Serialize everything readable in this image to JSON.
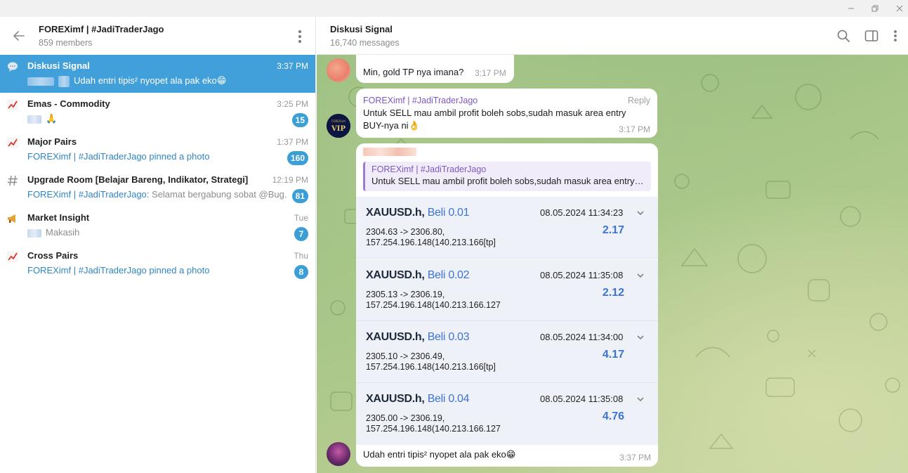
{
  "window": {
    "controls": [
      "minimize-icon",
      "restore-icon",
      "close-icon"
    ]
  },
  "left": {
    "title": "FOREXimf | #JadiTraderJago",
    "subtitle": "859 members",
    "topics": [
      {
        "icon": "chat-bubble-icon",
        "name": "Diskusi Signal",
        "time": "3:37 PM",
        "preview_from": "",
        "preview": "Udah entri tipis² nyopet ala pak eko😁",
        "badge": "",
        "active": true
      },
      {
        "icon": "chart-up-icon",
        "name": "Emas - Commodity",
        "time": "3:25 PM",
        "preview_from": "",
        "preview": "🙏",
        "badge": "15",
        "active": false
      },
      {
        "icon": "chart-up-icon",
        "name": "Major Pairs",
        "time": "1:37 PM",
        "preview_from": "FOREXimf | #JadiTraderJago pinned a photo",
        "preview": "",
        "badge": "160",
        "active": false
      },
      {
        "icon": "hash-icon",
        "name": "Upgrade Room [Belajar Bareng, Indikator, Strategi]",
        "time": "12:19 PM",
        "preview_from": "FOREXimf | #JadiTraderJago:",
        "preview": " Selamat bergabung sobat @Bug...",
        "badge": "81",
        "active": false
      },
      {
        "icon": "megaphone-icon",
        "name": "Market Insight",
        "time": "Tue",
        "preview_from": "",
        "preview": "Makasih",
        "badge": "7",
        "active": false
      },
      {
        "icon": "chart-up-icon",
        "name": "Cross Pairs",
        "time": "Thu",
        "preview_from": "FOREXimf | #JadiTraderJago pinned a photo",
        "preview": "",
        "badge": "8",
        "active": false
      }
    ]
  },
  "right": {
    "title": "Diskusi Signal",
    "subtitle": "16,740 messages",
    "messages": {
      "m1": {
        "text": "Min,  gold TP nya imana?",
        "time": "3:17 PM"
      },
      "m2": {
        "sender": "FOREXimf | #JadiTraderJago",
        "reply_label": "Reply",
        "line1": "Untuk SELL mau ambil profit boleh sobs,sudah masuk area entry",
        "line2": "BUY-nya ni👌",
        "time": "3:17 PM"
      },
      "m3": {
        "quote_name": "FOREXimf | #JadiTraderJago",
        "quote_text": "Untuk SELL mau ambil profit boleh sobs,sudah masuk area entry BUY-nya ni👌",
        "trades": [
          {
            "symbol": "XAUUSD.h,",
            "side": "Beli 0.01",
            "datetime": "08.05.2024 11:34:23",
            "prices": "2304.63 -> 2306.80,",
            "ip": "157.254.196.148(140.213.166[tp]",
            "profit": "2.17"
          },
          {
            "symbol": "XAUUSD.h,",
            "side": "Beli 0.02",
            "datetime": "08.05.2024 11:35:08",
            "prices": "2305.13 -> 2306.19,",
            "ip": "157.254.196.148(140.213.166.127",
            "profit": "2.12"
          },
          {
            "symbol": "XAUUSD.h,",
            "side": "Beli 0.03",
            "datetime": "08.05.2024 11:34:00",
            "prices": "2305.10 -> 2306.49,",
            "ip": "157.254.196.148(140.213.166[tp]",
            "profit": "4.17"
          },
          {
            "symbol": "XAUUSD.h,",
            "side": "Beli 0.04",
            "datetime": "08.05.2024 11:35:08",
            "prices": "2305.00 -> 2306.19,",
            "ip": "157.254.196.148(140.213.166.127",
            "profit": "4.76"
          }
        ],
        "caption": "Udah entri tipis² nyopet ala pak eko😁",
        "time": "3:37 PM"
      }
    }
  },
  "colors": {
    "accent": "#419fd9",
    "badge": "#3a9fd6",
    "sender": "#7e57c2",
    "profit": "#3d74d4"
  }
}
